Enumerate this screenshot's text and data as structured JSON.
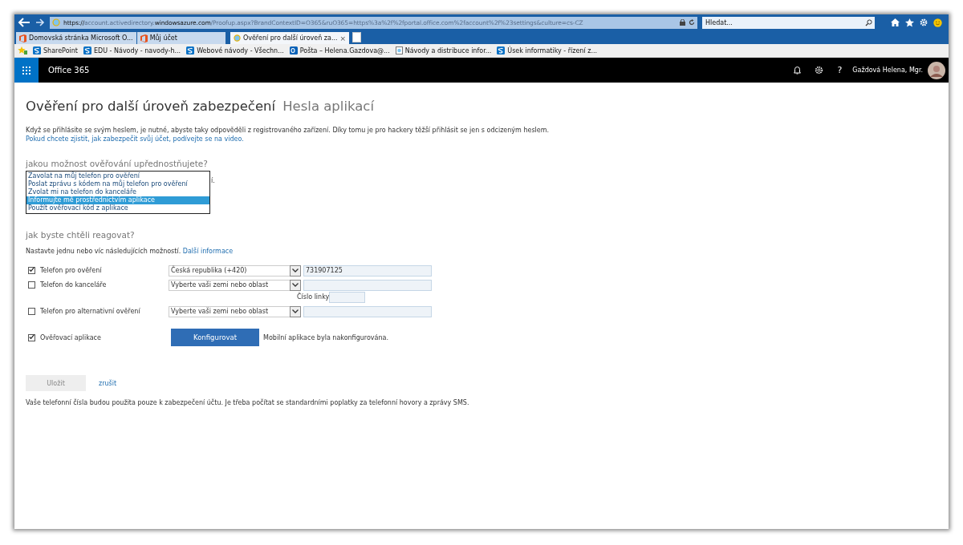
{
  "browser": {
    "url_prefix": "https://",
    "url_domain_start": "account.activedirectory.",
    "url_domain": "windowsazure.com",
    "url_path": "/Proofup.aspx?BrandContextID=O365&ruO365=https%3a%2f%2fportal.office.com%2faccount%2f%23settings&culture=cs-CZ",
    "search": {
      "placeholder": "Hledat..."
    },
    "tabs": [
      {
        "label": "Domovská stránka Microsoft O...",
        "selected": false,
        "kind": "office",
        "closable": false
      },
      {
        "label": "Můj účet",
        "selected": false,
        "kind": "office",
        "closable": false
      },
      {
        "label": "Ověření pro další úroveň za...",
        "selected": true,
        "kind": "ie",
        "closable": true
      }
    ],
    "close_glyph": "×",
    "favorites": [
      {
        "label": "SharePoint",
        "kind": "sharepoint"
      },
      {
        "label": "EDU - Návody - navody-h...",
        "kind": "sharepoint"
      },
      {
        "label": "Webové návody - Všechn...",
        "kind": "sharepoint"
      },
      {
        "label": "Pošta – Helena.Gazdova@...",
        "kind": "outlook"
      },
      {
        "label": "Návody a distribuce infor...",
        "kind": "page"
      },
      {
        "label": "Úsek informatiky - řízení z...",
        "kind": "sharepoint"
      }
    ]
  },
  "header": {
    "app_name": "Office 365",
    "help_glyph": "?",
    "user_name": "Gaždová Helena, Mgr."
  },
  "page": {
    "title": "Ověření pro další úroveň zabezpečení",
    "title_secondary": "Hesla aplikací",
    "intro": "Když se přihlásite se svým heslem, je nutné, abyste taky odpověděli z registrovaného zařízení. Díky tomu je pro hackery těžší přihlásit se jen s odcizeným heslem.",
    "intro_link": "Pokud chcete zjistit, jak zabezpečit svůj účet, podívejte se na video.",
    "question1": "jakou možnost ověřování upřednostňujete?",
    "behind_text": "í.",
    "options": [
      {
        "label": "Zavolat na můj telefon pro ověření",
        "selected": false
      },
      {
        "label": "Poslat zprávu s kódem na můj telefon pro ověření",
        "selected": false
      },
      {
        "label": "Zvolat mi na telefon do kanceláře",
        "selected": false
      },
      {
        "label": "Informujte mě prostřednictvím aplikace",
        "selected": true
      },
      {
        "label": "Použít ověřovací kód z aplikace",
        "selected": false
      }
    ],
    "question2": "jak byste chtěli reagovat?",
    "hint": "Nastavte jednu nebo víc následujících možností.",
    "hint_link": "Další informace",
    "methods": [
      {
        "kind": "phone",
        "label": "Telefon pro ověření",
        "checked": true,
        "country": "Česká republika (+420)",
        "number": "731907125"
      },
      {
        "kind": "office",
        "label": "Telefon do kanceláře",
        "checked": false,
        "country": "Vyberte vaši zemi nebo oblast",
        "extension_label": "Číslo linky"
      },
      {
        "kind": "phone",
        "label": "Telefon pro alternativní ověření",
        "checked": false,
        "country": "Vyberte vaši zemi nebo oblast"
      },
      {
        "kind": "app",
        "label": "Ověřovací aplikace",
        "checked": true,
        "button": "Konfigurovat",
        "status": "Mobilní aplikace byla nakonfigurována."
      }
    ],
    "save": {
      "label": "Uložit",
      "disabled": true
    },
    "cancel": "zrušit",
    "footer": "Vaše telefonní čísla budou použita pouze k zabezpečení účtu. Je třeba počítat se standardními poplatky za telefonní hovory a zprávy SMS."
  }
}
